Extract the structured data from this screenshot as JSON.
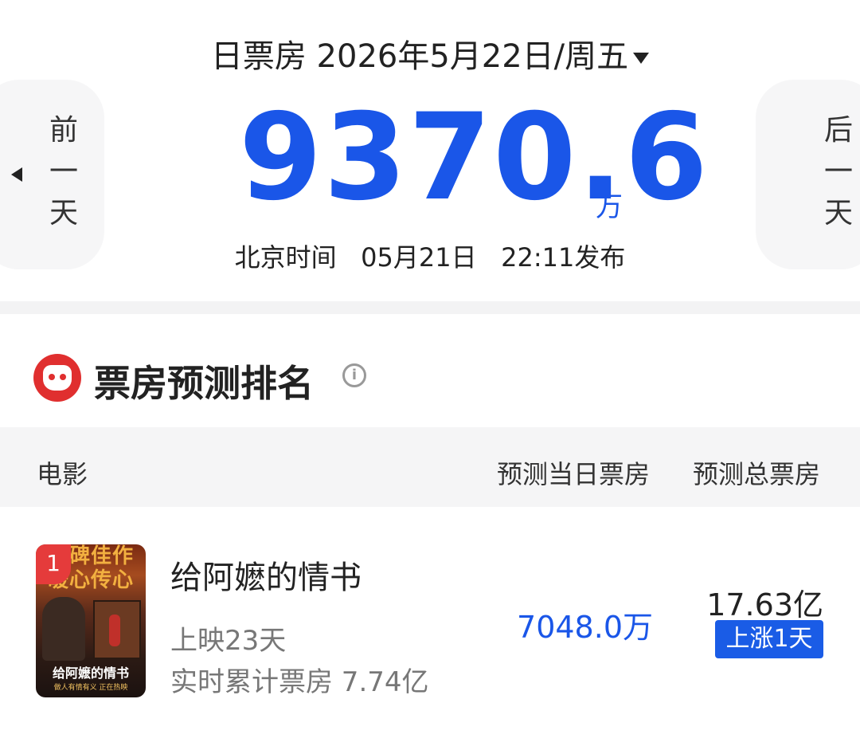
{
  "header": {
    "title": "日票房 2026年5月22日/周五"
  },
  "nav": {
    "prev_label": [
      "前",
      "一",
      "天"
    ],
    "next_label": [
      "后",
      "一",
      "天"
    ]
  },
  "summary": {
    "box_office_value": "9370.6",
    "box_office_unit": "万",
    "publish_prefix": "北京时间",
    "publish_date": "05月21日",
    "publish_time": "22:11发布"
  },
  "ranking": {
    "title": "票房预测排名",
    "columns": {
      "movie": "电影",
      "predict_day": "预测当日票房",
      "predict_total": "预测总票房"
    },
    "rows": [
      {
        "rank": "1",
        "poster_top_text": "口碑佳作 暖心传心",
        "poster_title": "给阿嬷的情书",
        "poster_sub": "做人有情有义 正在热映",
        "title": "给阿嬷的情书",
        "days": "上映23天",
        "cumulative": "实时累计票房 7.74亿",
        "predict_day": "7048.0万",
        "predict_total": "17.63亿",
        "trend": "上涨1天"
      }
    ]
  },
  "colors": {
    "accent": "#1a56e8",
    "brand_red": "#e02f2f",
    "badge_blue": "#1a5ce6"
  }
}
